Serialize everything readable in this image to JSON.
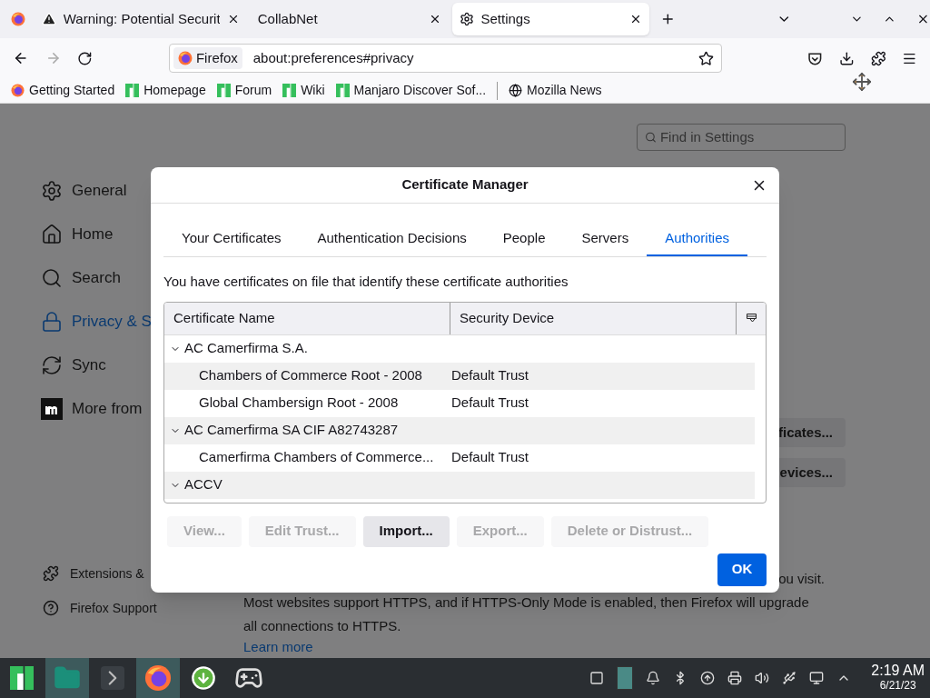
{
  "browser": {
    "tabs": [
      {
        "label": "Warning: Potential Securit",
        "selected": false,
        "kind": "warning"
      },
      {
        "label": "CollabNet",
        "selected": false,
        "kind": "plain"
      },
      {
        "label": "Settings",
        "selected": true,
        "kind": "settings"
      }
    ],
    "identity": "Firefox",
    "url": "about:preferences#privacy",
    "bookmarks": [
      {
        "label": "Getting Started",
        "kind": "firefox"
      },
      {
        "label": "Homepage",
        "kind": "manjaro"
      },
      {
        "label": "Forum",
        "kind": "manjaro"
      },
      {
        "label": "Wiki",
        "kind": "manjaro"
      },
      {
        "label": "Manjaro Discover Sof...",
        "kind": "manjaro"
      },
      {
        "label": "Mozilla News",
        "kind": "globe"
      }
    ]
  },
  "settings": {
    "search_placeholder": "Find in Settings",
    "sidebar": [
      {
        "label": "General",
        "selected": false
      },
      {
        "label": "Home",
        "selected": false
      },
      {
        "label": "Search",
        "selected": false
      },
      {
        "label": "Privacy & S",
        "selected": true
      },
      {
        "label": "Sync",
        "selected": false
      },
      {
        "label": "More from ",
        "selected": false
      }
    ],
    "sidebar_footer": [
      "Extensions &",
      "Firefox Support"
    ],
    "buttons": [
      "ficates...",
      "evices..."
    ],
    "text_lines": [
      "ou visit.",
      "Most websites support HTTPS, and if HTTPS-Only Mode is enabled, then Firefox will upgrade",
      "all connections to HTTPS."
    ],
    "link": "Learn more"
  },
  "dialog": {
    "title": "Certificate Manager",
    "tabs": [
      {
        "label": "Your Certificates",
        "selected": false
      },
      {
        "label": "Authentication Decisions",
        "selected": false
      },
      {
        "label": "People",
        "selected": false
      },
      {
        "label": "Servers",
        "selected": false
      },
      {
        "label": "Authorities",
        "selected": true
      }
    ],
    "description": "You have certificates on file that identify these certificate authorities",
    "columns": [
      "Certificate Name",
      "Security Device"
    ],
    "tree": [
      {
        "name": "AC Camerfirma S.A.",
        "expanded": true,
        "children": [
          {
            "name": "Chambers of Commerce Root - 2008",
            "device": "Default Trust"
          },
          {
            "name": "Global Chambersign Root - 2008",
            "device": "Default Trust"
          }
        ]
      },
      {
        "name": "AC Camerfirma SA CIF A82743287",
        "expanded": true,
        "children": [
          {
            "name": "Camerfirma Chambers of Commerce...",
            "device": "Default Trust"
          }
        ]
      },
      {
        "name": "ACCV",
        "expanded": true
      }
    ],
    "actions": [
      {
        "label": "View...",
        "disabled": true
      },
      {
        "label": "Edit Trust...",
        "disabled": true
      },
      {
        "label": "Import...",
        "disabled": false
      },
      {
        "label": "Export...",
        "disabled": true
      },
      {
        "label": "Delete or Distrust...",
        "disabled": true
      }
    ],
    "ok": "OK"
  },
  "taskbar": {
    "launchers": [
      {
        "active": false
      },
      {
        "active": true
      },
      {
        "active": false
      },
      {
        "active": true
      },
      {
        "active": false
      },
      {
        "active": false
      }
    ],
    "time": "2:19 AM",
    "date": "6/21/23"
  }
}
